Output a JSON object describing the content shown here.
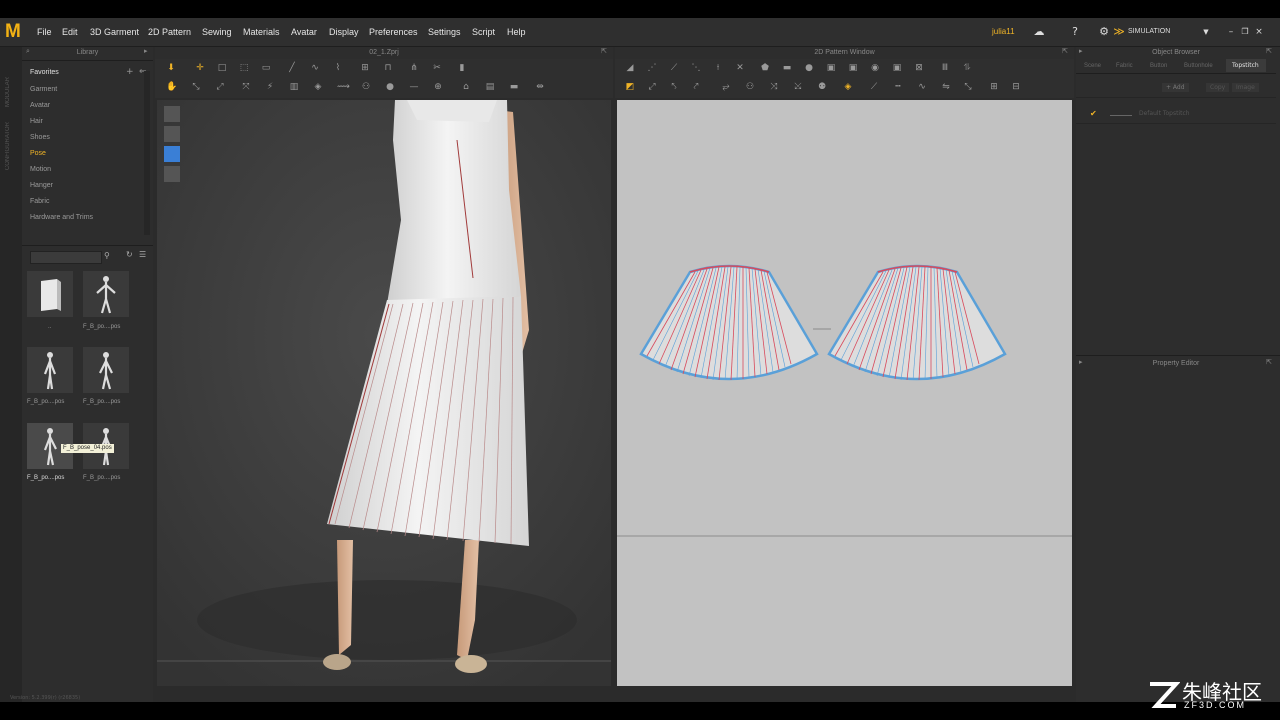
{
  "app": {
    "logo": "M",
    "menu": [
      "File",
      "Edit",
      "3D Garment",
      "2D Pattern",
      "Sewing",
      "Materials",
      "Avatar",
      "Display",
      "Preferences",
      "Settings",
      "Script",
      "Help"
    ],
    "user": "julia11",
    "mode": "SIMULATION"
  },
  "left_strip": {
    "tabs": [
      "MODULAR",
      "CONFIGURATOR"
    ]
  },
  "library": {
    "title": "Library",
    "items": [
      "Favorites",
      "Garment",
      "Avatar",
      "Hair",
      "Shoes",
      "Pose",
      "Motion",
      "Hanger",
      "Fabric",
      "Hardware and Trims"
    ],
    "selected": "Pose",
    "thumbnails": [
      {
        "label": ".."
      },
      {
        "label": "F_B_po....pos"
      },
      {
        "label": "F_B_po....pos"
      },
      {
        "label": "F_B_po....pos"
      },
      {
        "label": "F_B_po....pos"
      },
      {
        "label": "F_B_po....pos"
      }
    ],
    "tooltip": "F_B_pose_04.pos",
    "status": "Version: 5.2.399(r) (r26835)"
  },
  "view3d": {
    "title": "02_1.Zprj"
  },
  "pattern2d": {
    "title": "2D Pattern Window"
  },
  "right": {
    "title": "Object Browser",
    "tabs": [
      "Scene",
      "Fabric",
      "Button",
      "Buttonhole",
      "Topstitch"
    ],
    "active_tab": "Topstitch",
    "buttons": [
      "+ Add",
      "Copy",
      "Image"
    ],
    "topstitch_item": "Default Topstitch",
    "property_title": "Property Editor"
  },
  "watermark": {
    "text": "朱峰社区",
    "url": "ZF3D.COM"
  },
  "colors": {
    "accent": "#f0b427",
    "panel": "#2d2d2d",
    "pattern_bg": "#c2c2c2"
  }
}
